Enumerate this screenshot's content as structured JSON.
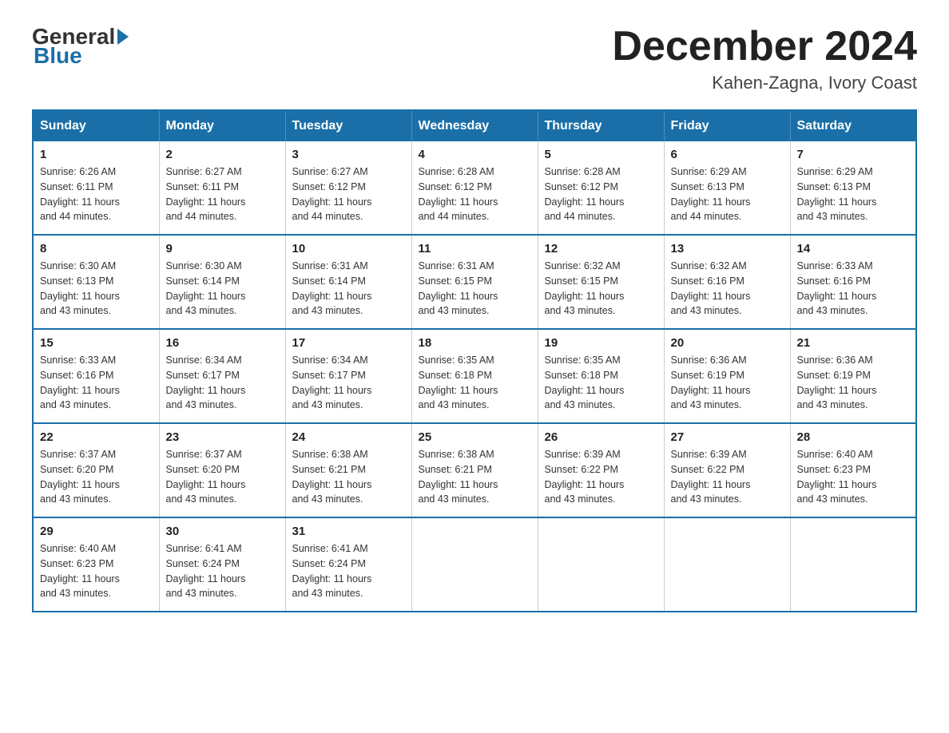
{
  "header": {
    "logo_general": "General",
    "logo_blue": "Blue",
    "month_title": "December 2024",
    "location": "Kahen-Zagna, Ivory Coast"
  },
  "weekdays": [
    "Sunday",
    "Monday",
    "Tuesday",
    "Wednesday",
    "Thursday",
    "Friday",
    "Saturday"
  ],
  "weeks": [
    [
      {
        "day": "1",
        "sunrise": "6:26 AM",
        "sunset": "6:11 PM",
        "daylight": "11 hours and 44 minutes."
      },
      {
        "day": "2",
        "sunrise": "6:27 AM",
        "sunset": "6:11 PM",
        "daylight": "11 hours and 44 minutes."
      },
      {
        "day": "3",
        "sunrise": "6:27 AM",
        "sunset": "6:12 PM",
        "daylight": "11 hours and 44 minutes."
      },
      {
        "day": "4",
        "sunrise": "6:28 AM",
        "sunset": "6:12 PM",
        "daylight": "11 hours and 44 minutes."
      },
      {
        "day": "5",
        "sunrise": "6:28 AM",
        "sunset": "6:12 PM",
        "daylight": "11 hours and 44 minutes."
      },
      {
        "day": "6",
        "sunrise": "6:29 AM",
        "sunset": "6:13 PM",
        "daylight": "11 hours and 44 minutes."
      },
      {
        "day": "7",
        "sunrise": "6:29 AM",
        "sunset": "6:13 PM",
        "daylight": "11 hours and 43 minutes."
      }
    ],
    [
      {
        "day": "8",
        "sunrise": "6:30 AM",
        "sunset": "6:13 PM",
        "daylight": "11 hours and 43 minutes."
      },
      {
        "day": "9",
        "sunrise": "6:30 AM",
        "sunset": "6:14 PM",
        "daylight": "11 hours and 43 minutes."
      },
      {
        "day": "10",
        "sunrise": "6:31 AM",
        "sunset": "6:14 PM",
        "daylight": "11 hours and 43 minutes."
      },
      {
        "day": "11",
        "sunrise": "6:31 AM",
        "sunset": "6:15 PM",
        "daylight": "11 hours and 43 minutes."
      },
      {
        "day": "12",
        "sunrise": "6:32 AM",
        "sunset": "6:15 PM",
        "daylight": "11 hours and 43 minutes."
      },
      {
        "day": "13",
        "sunrise": "6:32 AM",
        "sunset": "6:16 PM",
        "daylight": "11 hours and 43 minutes."
      },
      {
        "day": "14",
        "sunrise": "6:33 AM",
        "sunset": "6:16 PM",
        "daylight": "11 hours and 43 minutes."
      }
    ],
    [
      {
        "day": "15",
        "sunrise": "6:33 AM",
        "sunset": "6:16 PM",
        "daylight": "11 hours and 43 minutes."
      },
      {
        "day": "16",
        "sunrise": "6:34 AM",
        "sunset": "6:17 PM",
        "daylight": "11 hours and 43 minutes."
      },
      {
        "day": "17",
        "sunrise": "6:34 AM",
        "sunset": "6:17 PM",
        "daylight": "11 hours and 43 minutes."
      },
      {
        "day": "18",
        "sunrise": "6:35 AM",
        "sunset": "6:18 PM",
        "daylight": "11 hours and 43 minutes."
      },
      {
        "day": "19",
        "sunrise": "6:35 AM",
        "sunset": "6:18 PM",
        "daylight": "11 hours and 43 minutes."
      },
      {
        "day": "20",
        "sunrise": "6:36 AM",
        "sunset": "6:19 PM",
        "daylight": "11 hours and 43 minutes."
      },
      {
        "day": "21",
        "sunrise": "6:36 AM",
        "sunset": "6:19 PM",
        "daylight": "11 hours and 43 minutes."
      }
    ],
    [
      {
        "day": "22",
        "sunrise": "6:37 AM",
        "sunset": "6:20 PM",
        "daylight": "11 hours and 43 minutes."
      },
      {
        "day": "23",
        "sunrise": "6:37 AM",
        "sunset": "6:20 PM",
        "daylight": "11 hours and 43 minutes."
      },
      {
        "day": "24",
        "sunrise": "6:38 AM",
        "sunset": "6:21 PM",
        "daylight": "11 hours and 43 minutes."
      },
      {
        "day": "25",
        "sunrise": "6:38 AM",
        "sunset": "6:21 PM",
        "daylight": "11 hours and 43 minutes."
      },
      {
        "day": "26",
        "sunrise": "6:39 AM",
        "sunset": "6:22 PM",
        "daylight": "11 hours and 43 minutes."
      },
      {
        "day": "27",
        "sunrise": "6:39 AM",
        "sunset": "6:22 PM",
        "daylight": "11 hours and 43 minutes."
      },
      {
        "day": "28",
        "sunrise": "6:40 AM",
        "sunset": "6:23 PM",
        "daylight": "11 hours and 43 minutes."
      }
    ],
    [
      {
        "day": "29",
        "sunrise": "6:40 AM",
        "sunset": "6:23 PM",
        "daylight": "11 hours and 43 minutes."
      },
      {
        "day": "30",
        "sunrise": "6:41 AM",
        "sunset": "6:24 PM",
        "daylight": "11 hours and 43 minutes."
      },
      {
        "day": "31",
        "sunrise": "6:41 AM",
        "sunset": "6:24 PM",
        "daylight": "11 hours and 43 minutes."
      },
      null,
      null,
      null,
      null
    ]
  ],
  "labels": {
    "sunrise": "Sunrise:",
    "sunset": "Sunset:",
    "daylight": "Daylight:"
  }
}
